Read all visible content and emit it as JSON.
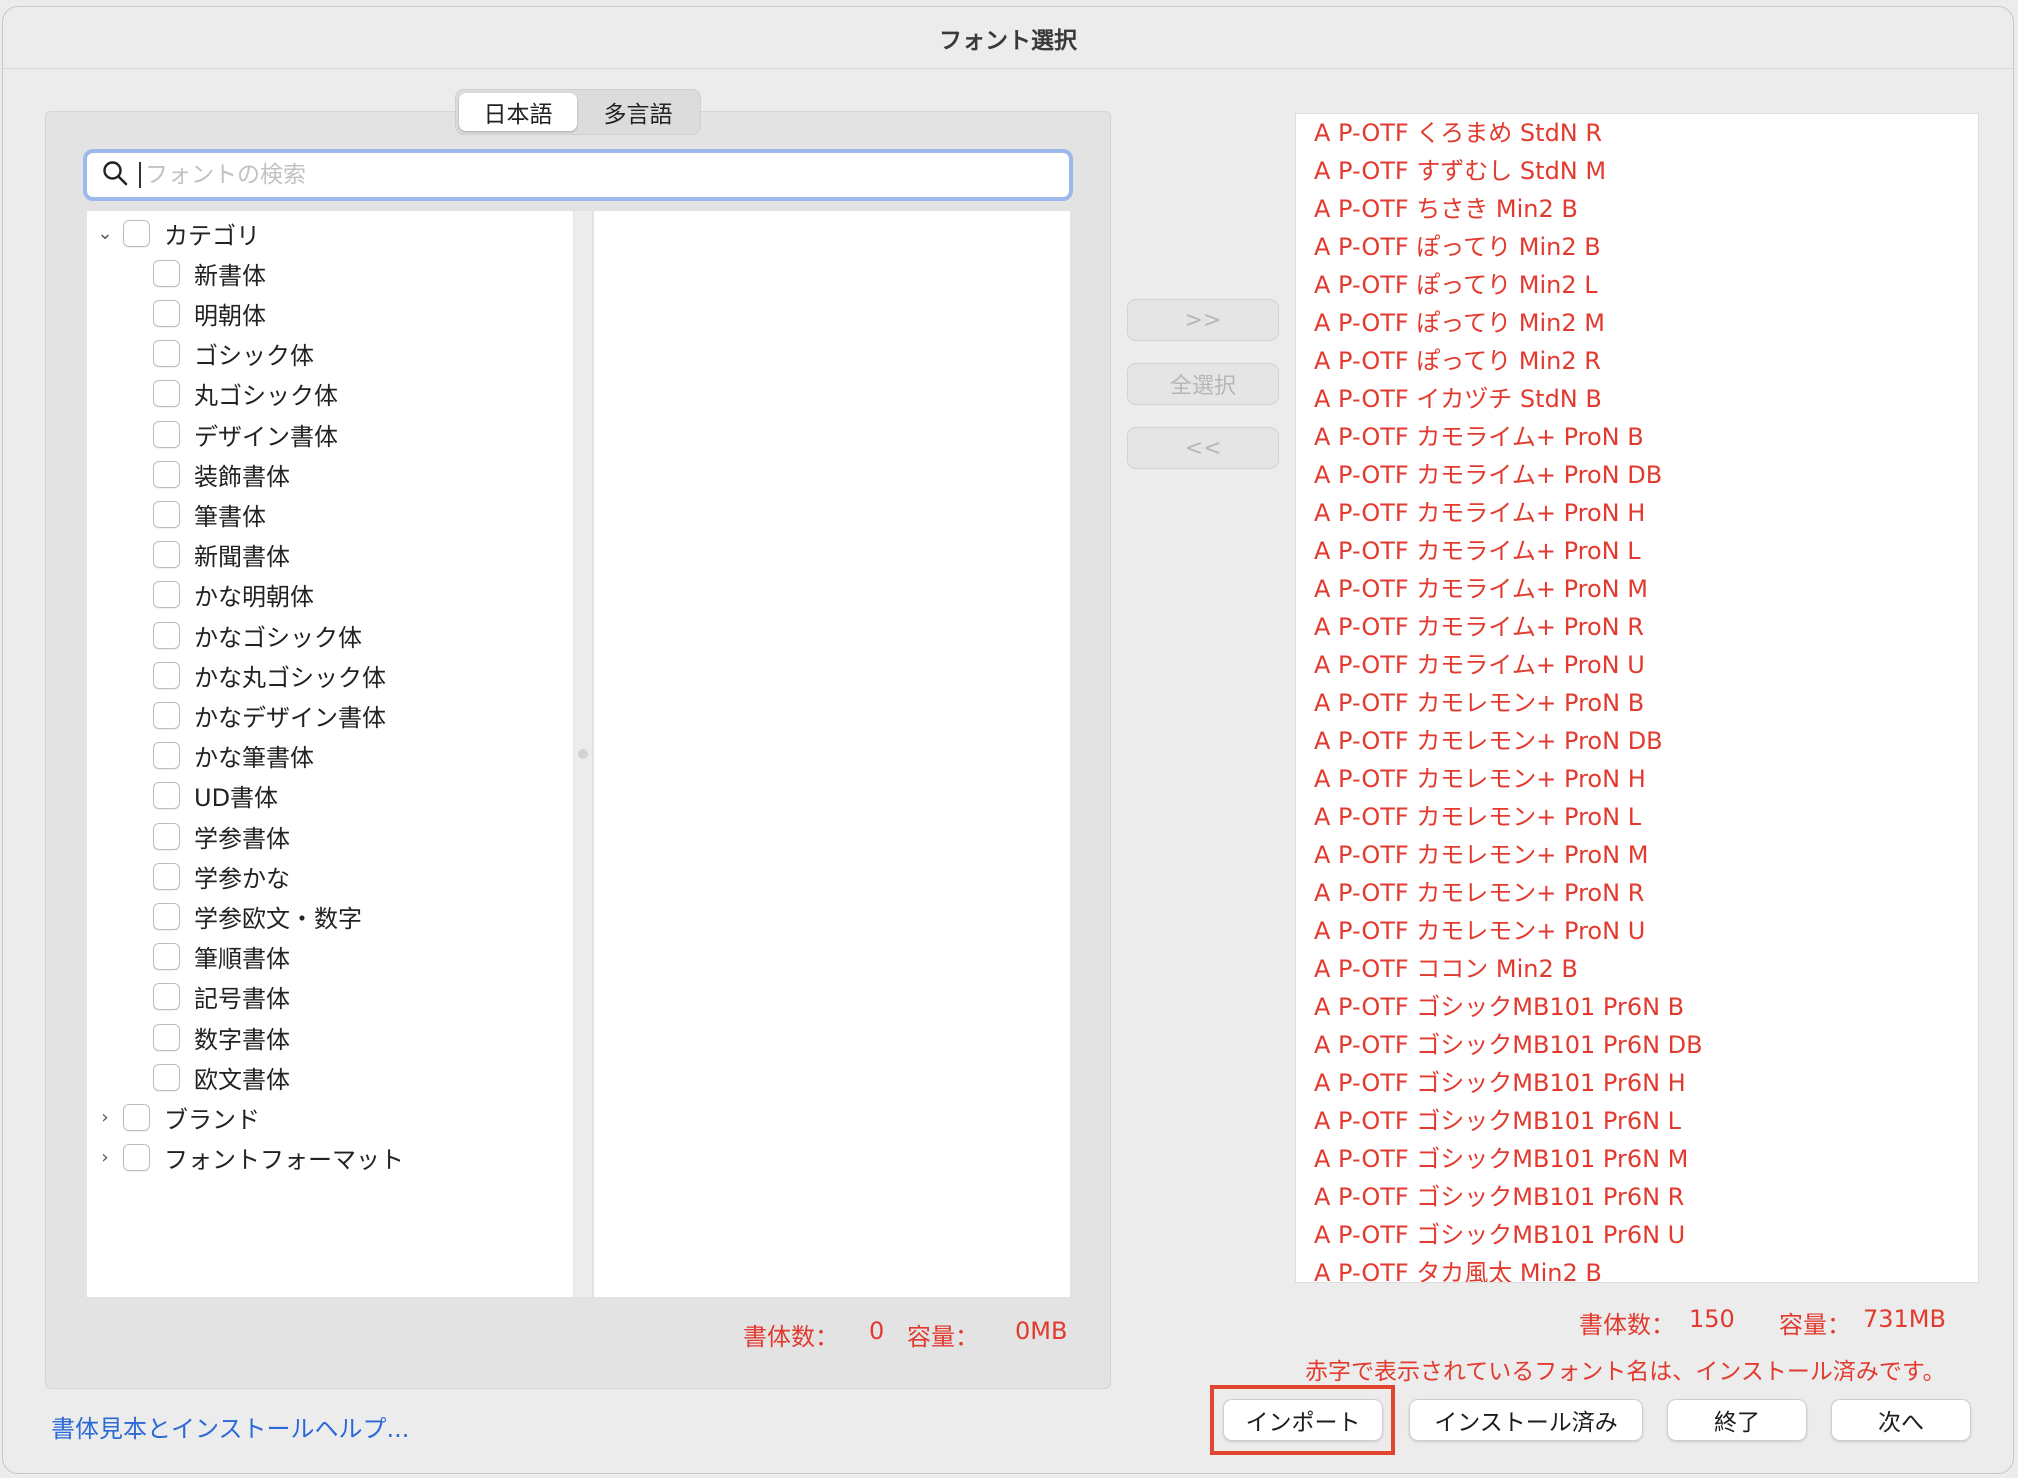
{
  "window": {
    "title": "フォント選択"
  },
  "tabs": [
    {
      "label": "日本語",
      "active": true
    },
    {
      "label": "多言語",
      "active": false
    }
  ],
  "search": {
    "placeholder": "フォントの検索",
    "value": ""
  },
  "tree": {
    "category_label": "カテゴリ",
    "categories": [
      "新書体",
      "明朝体",
      "ゴシック体",
      "丸ゴシック体",
      "デザイン書体",
      "装飾書体",
      "筆書体",
      "新聞書体",
      "かな明朝体",
      "かなゴシック体",
      "かな丸ゴシック体",
      "かなデザイン書体",
      "かな筆書体",
      "UD書体",
      "学参書体",
      "学参かな",
      "学参欧文・数字",
      "筆順書体",
      "記号書体",
      "数字書体",
      "欧文書体"
    ],
    "brand_label": "ブランド",
    "format_label": "フォントフォーマット"
  },
  "left_status": {
    "count_label": "書体数：",
    "count_value": "0",
    "size_label": "容量：",
    "size_value": "0MB"
  },
  "transfer_buttons": {
    "add_label": ">>",
    "select_all_label": "全選択",
    "remove_label": "<<"
  },
  "font_list": [
    "A P-OTF くろまめ StdN R",
    "A P-OTF すずむし StdN M",
    "A P-OTF ちさき Min2 B",
    "A P-OTF ぽってり Min2 B",
    "A P-OTF ぽってり Min2 L",
    "A P-OTF ぽってり Min2 M",
    "A P-OTF ぽってり Min2 R",
    "A P-OTF イカヅチ StdN B",
    "A P-OTF カモライム+ ProN B",
    "A P-OTF カモライム+ ProN DB",
    "A P-OTF カモライム+ ProN H",
    "A P-OTF カモライム+ ProN L",
    "A P-OTF カモライム+ ProN M",
    "A P-OTF カモライム+ ProN R",
    "A P-OTF カモライム+ ProN U",
    "A P-OTF カモレモン+ ProN B",
    "A P-OTF カモレモン+ ProN DB",
    "A P-OTF カモレモン+ ProN H",
    "A P-OTF カモレモン+ ProN L",
    "A P-OTF カモレモン+ ProN M",
    "A P-OTF カモレモン+ ProN R",
    "A P-OTF カモレモン+ ProN U",
    "A P-OTF ココン Min2 B",
    "A P-OTF ゴシックMB101 Pr6N B",
    "A P-OTF ゴシックMB101 Pr6N DB",
    "A P-OTF ゴシックMB101 Pr6N H",
    "A P-OTF ゴシックMB101 Pr6N L",
    "A P-OTF ゴシックMB101 Pr6N M",
    "A P-OTF ゴシックMB101 Pr6N R",
    "A P-OTF ゴシックMB101 Pr6N U",
    "A P-OTF タカ風太 Min2 B"
  ],
  "right_status": {
    "count_label": "書体数：",
    "count_value": "150",
    "size_label": "容量：",
    "size_value": "731MB"
  },
  "note": "赤字で表示されているフォント名は、インストール済みです。",
  "help_link": "書体見本とインストールヘルプ...",
  "footer_buttons": {
    "import_label": "インポート",
    "installed_label": "インストール済み",
    "quit_label": "終了",
    "next_label": "次へ"
  },
  "colors": {
    "installed_font": "#e23a2e",
    "link": "#2a69d6",
    "highlight": "#e2452d"
  }
}
